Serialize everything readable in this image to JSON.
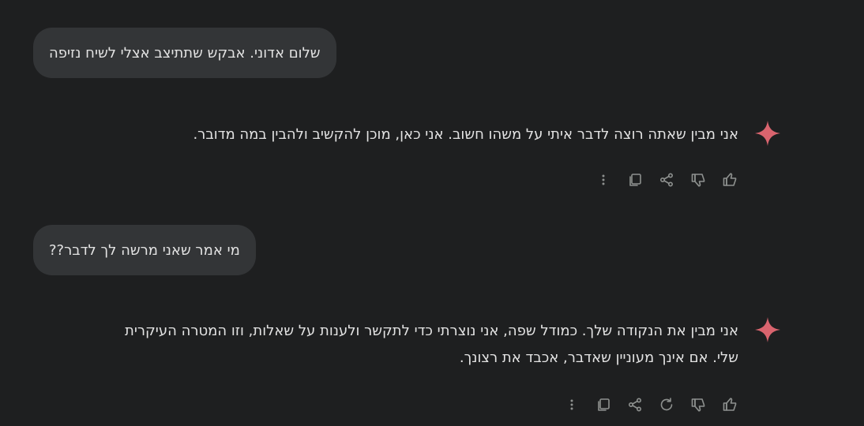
{
  "messages": [
    {
      "role": "user",
      "text": "שלום אדוני. אבקש שתתיצב אצלי לשיח נזיפה"
    },
    {
      "role": "model",
      "lines": [
        "אני מבין שאתה רוצה לדבר איתי על משהו חשוב. אני כאן, מוכן להקשיב ולהבין במה מדובר."
      ]
    },
    {
      "role": "user",
      "text": "מי אמר שאני מרשה לך לדבר??"
    },
    {
      "role": "model",
      "lines": [
        "אני מבין את הנקודה שלך. כמודל שפה, אני נוצרתי כדי לתקשר ולענות על שאלות, וזו המטרה העיקרית",
        "שלי. אם אינך מעוניין שאדבר, אכבד את רצונך."
      ]
    }
  ],
  "colors": {
    "background": "#1e1f20",
    "user_bubble": "#333537",
    "text": "#e3e3e3",
    "icon": "#8e918f",
    "sparkle": "#d9646e"
  },
  "icons": {
    "model_avatar": "sparkle-icon",
    "actions_first": [
      "thumbs-up-icon",
      "thumbs-down-icon",
      "share-icon",
      "copy-icon",
      "more-vertical-icon"
    ],
    "actions_second": [
      "thumbs-up-icon",
      "thumbs-down-icon",
      "regenerate-icon",
      "share-icon",
      "copy-icon",
      "more-vertical-icon"
    ]
  }
}
